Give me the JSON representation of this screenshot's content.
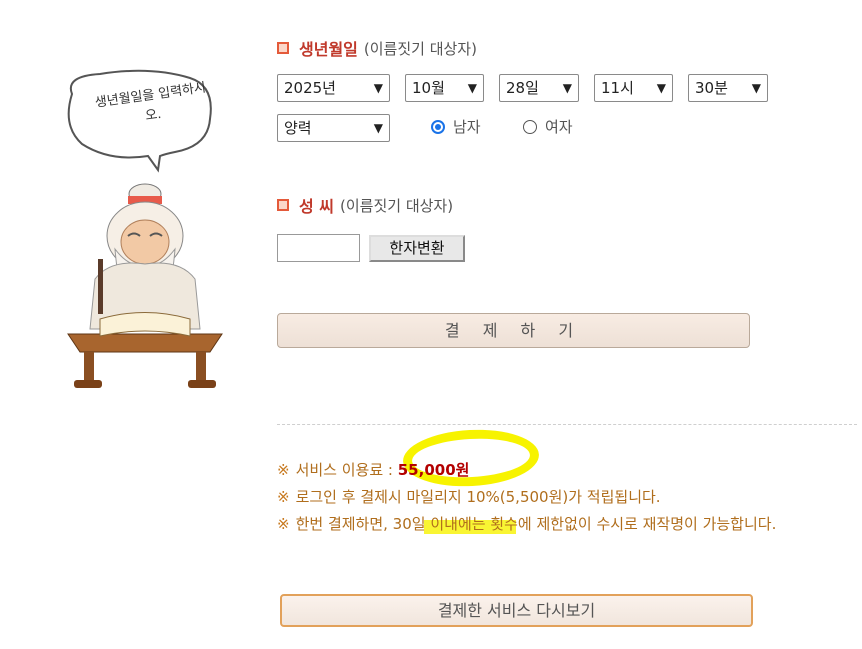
{
  "illustration": {
    "bubble_text": "생년월일을 입력하시오."
  },
  "birth_section": {
    "title": "생년월일",
    "subtitle": "(이름짓기 대상자)"
  },
  "selects": {
    "year": "2025년",
    "month": "10월",
    "day": "28일",
    "hour": "11시",
    "minute": "30분",
    "calendar": "양력"
  },
  "gender": {
    "male": "남자",
    "female": "여자",
    "selected": "남자"
  },
  "surname_section": {
    "title": "성 씨",
    "subtitle": "(이름짓기 대상자)"
  },
  "surname": {
    "value": "",
    "hanja_button": "한자변환"
  },
  "pay_button": "결 제 하 기",
  "notes": {
    "mark": "※",
    "fee_label": "서비스 이용료 :",
    "fee_value": "55,000원",
    "mileage": "로그인 후 결제시 마일리지 10%(5,500원)가 적립됩니다.",
    "unlimited": "한번 결제하면, 30일 이내에는 횟수에 제한없이 수시로 재작명이 가능합니다."
  },
  "review_button": "결제한 서비스 다시보기",
  "colors": {
    "highlight": "#f7f300",
    "accent": "#c0392b",
    "note_text": "#b06e1d"
  }
}
